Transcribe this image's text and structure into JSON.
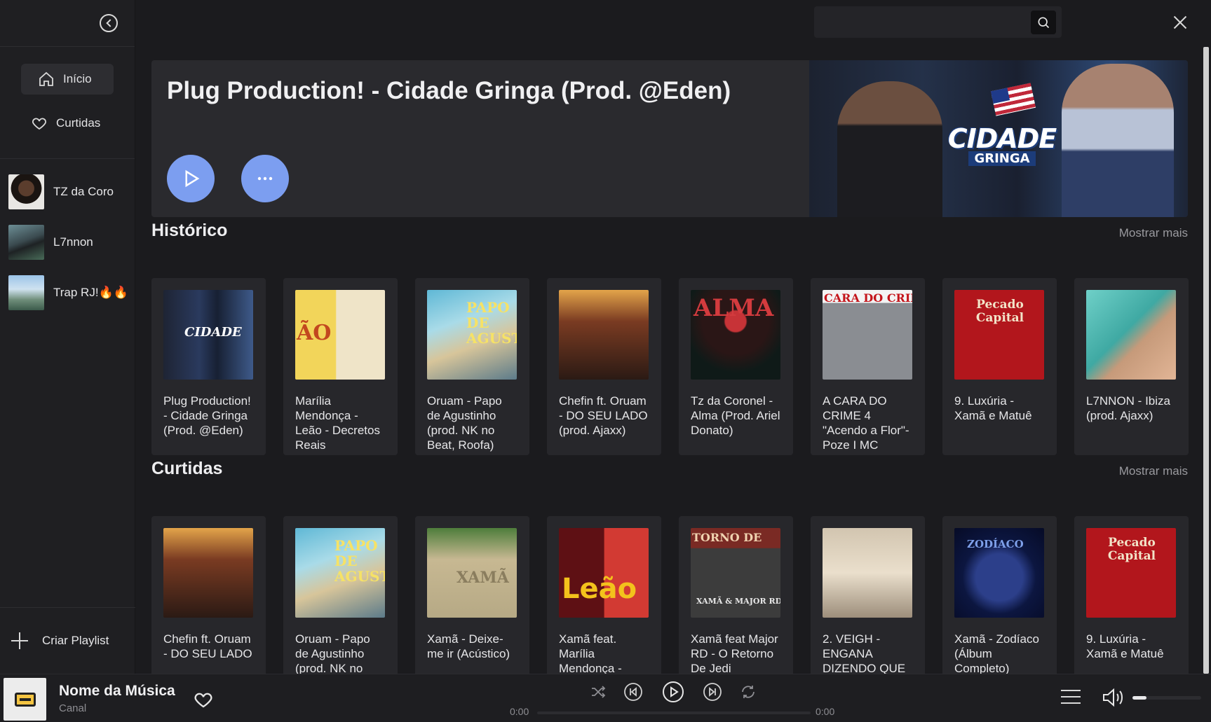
{
  "sidebar": {
    "nav": [
      {
        "label": "Início",
        "icon": "home-icon"
      },
      {
        "label": "Curtidas",
        "icon": "heart-icon"
      }
    ],
    "artists": [
      {
        "label": "TZ da Coro"
      },
      {
        "label": "L7nnon"
      },
      {
        "label": "Trap RJ!🔥🔥"
      }
    ],
    "create_playlist": "Criar Playlist"
  },
  "search": {
    "placeholder": ""
  },
  "hero": {
    "title": "Plug Production! - Cidade Gringa (Prod. @Eden)",
    "art_text_1": "CIDADE",
    "art_text_2": "GRINGA"
  },
  "historico": {
    "title": "Histórico",
    "show_more": "Mostrar mais",
    "items": [
      {
        "title": "Plug Production! - Cidade Gringa (Prod. @Eden)"
      },
      {
        "title": "Marília Mendonça - Leão - Decretos Reais"
      },
      {
        "title": "Oruam - Papo de Agustinho (prod. NK no Beat, Roofa)"
      },
      {
        "title": "Chefin ft. Oruam - DO SEU LADO (prod. Ajaxx)"
      },
      {
        "title": "Tz da Coronel - Alma (Prod. Ariel Donato)"
      },
      {
        "title": "A CARA DO CRIME 4 \"Acendo a Flor\"- Poze I MC"
      },
      {
        "title": "9. Luxúria - Xamã e Matuê"
      },
      {
        "title": "L7NNON - Ibiza (prod. Ajaxx)"
      }
    ]
  },
  "curtidas": {
    "title": "Curtidas",
    "show_more": "Mostrar mais",
    "items": [
      {
        "title": "Chefin ft. Oruam - DO SEU LADO"
      },
      {
        "title": "Oruam - Papo de Agustinho (prod. NK no"
      },
      {
        "title": "Xamã - Deixe-me ir (Acústico)"
      },
      {
        "title": "Xamã feat. Marília Mendonça -"
      },
      {
        "title": "Xamã feat Major RD - O Retorno De Jedi"
      },
      {
        "title": "2. VEIGH - ENGANA DIZENDO QUE"
      },
      {
        "title": "Xamã - Zodíaco (Álbum Completo)"
      },
      {
        "title": "9. Luxúria - Xamã e Matuê"
      }
    ]
  },
  "cover_text": {
    "marilia": "ÃO",
    "papo": "PAPO DE AGUSTIN",
    "alma": "ALMA",
    "crime": "CARA DO CRIM",
    "pecado": "Pecado Capital",
    "xama": "XAMÃ",
    "leao": "Leão",
    "jedi_top": "TORNO DE",
    "jedi_bottom": "XAMÃ & MAJOR RD",
    "zodiaco": "ZODÍACO"
  },
  "player": {
    "song": "Nome da Música",
    "channel": "Canal",
    "time_current": "0:00",
    "time_total": "0:00",
    "progress": 0,
    "volume": 0.2
  }
}
